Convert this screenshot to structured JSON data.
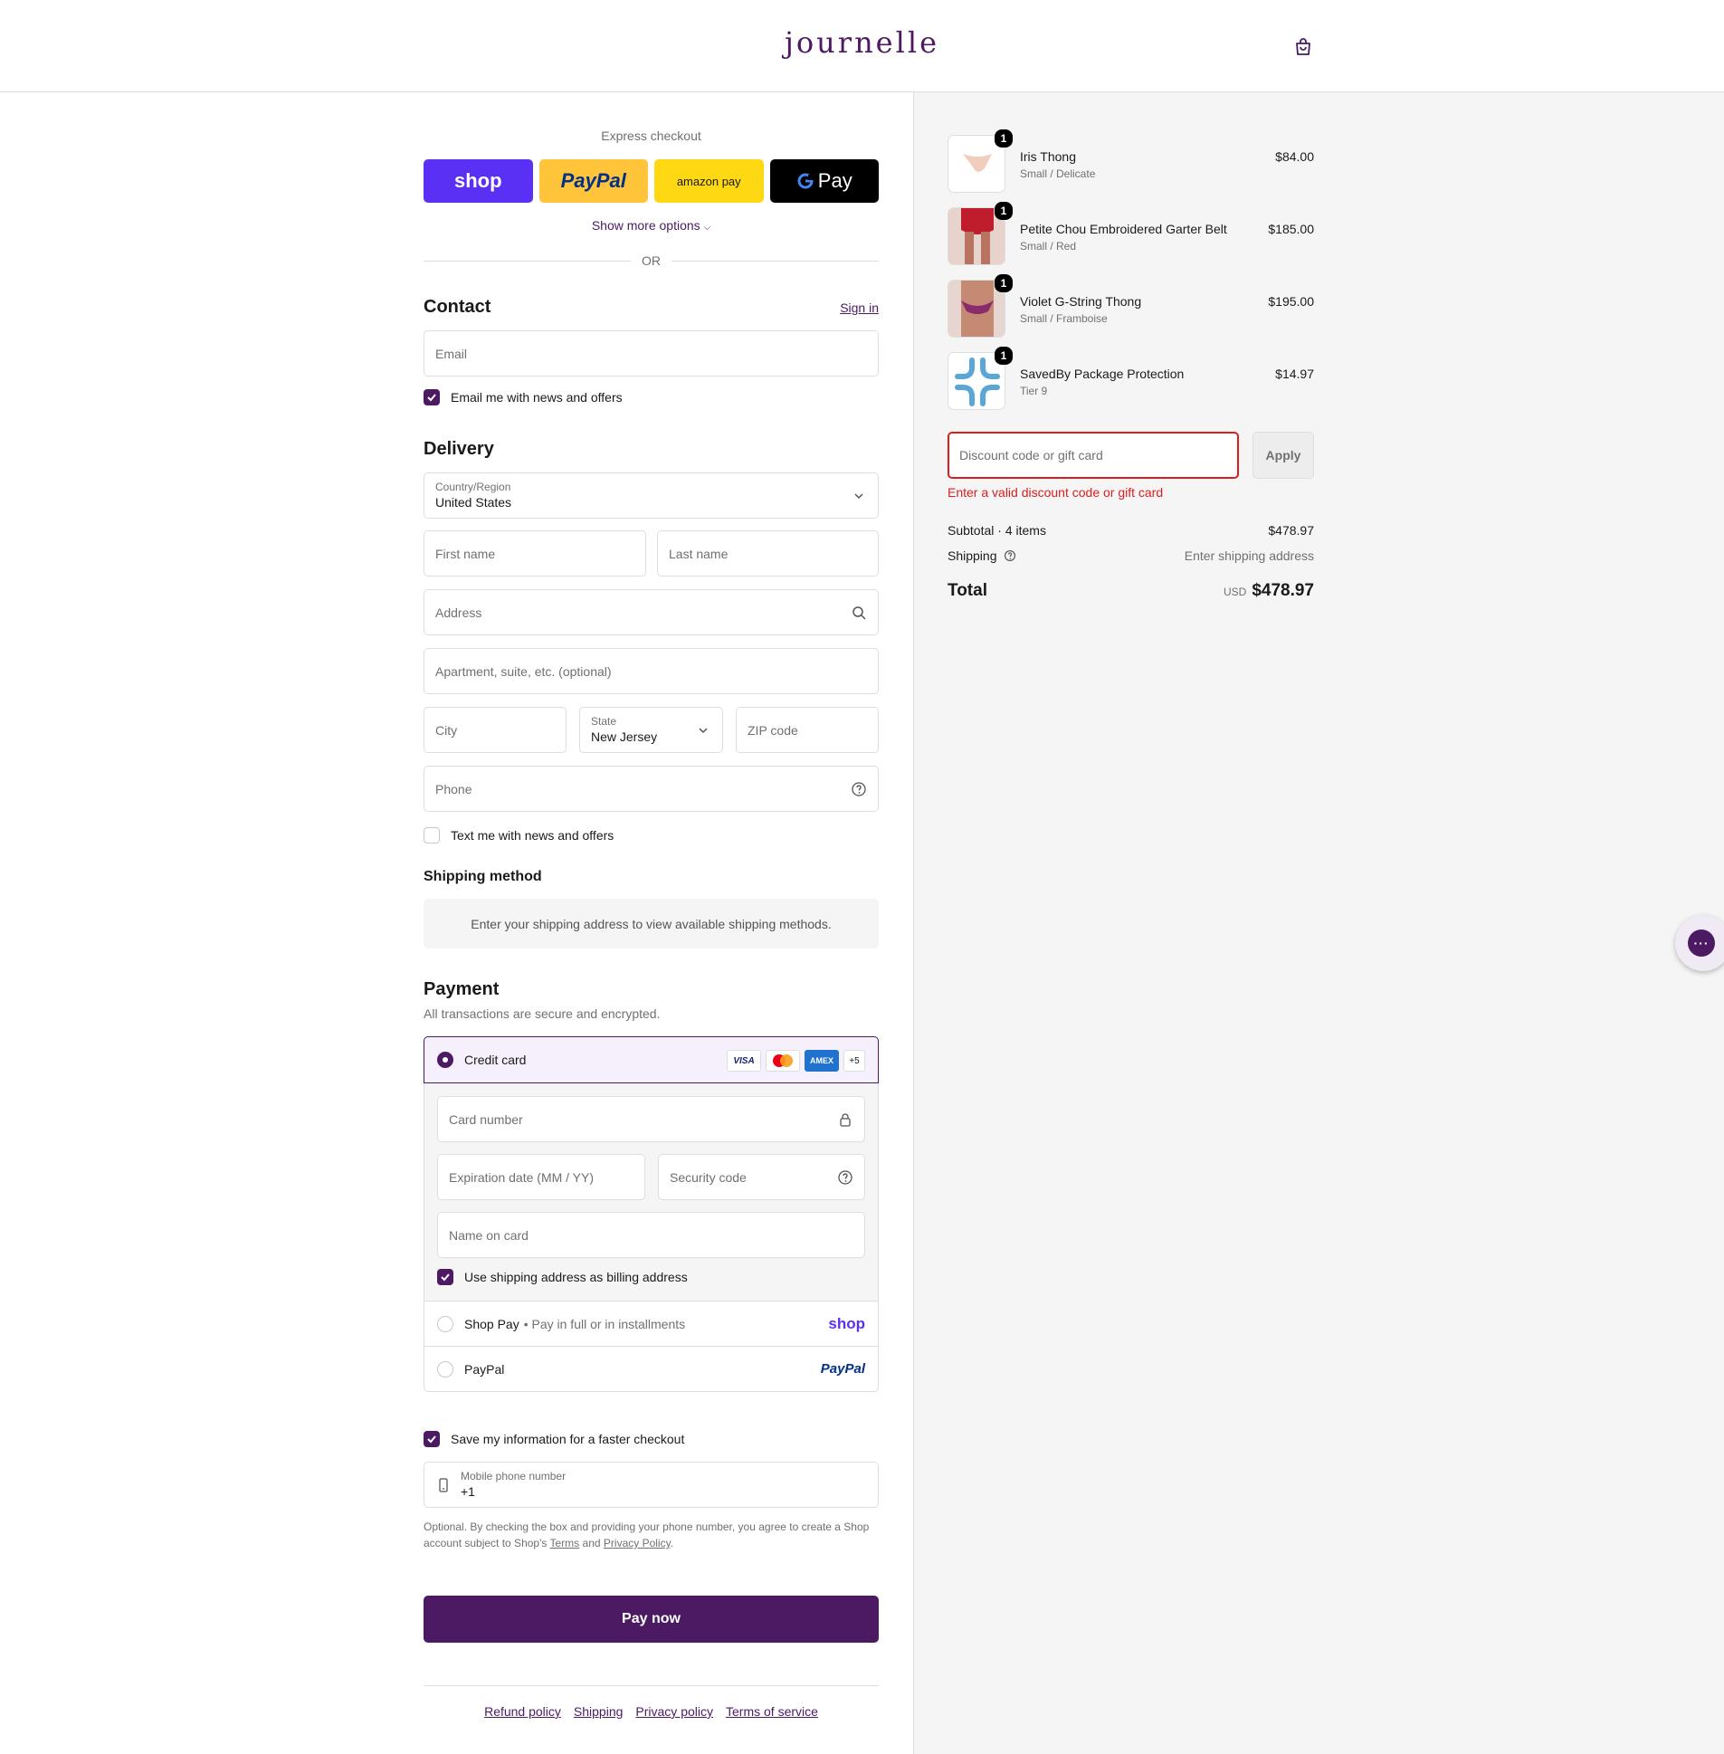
{
  "header": {
    "logo": "journelle",
    "cart_icon": "shopping-bag-icon"
  },
  "express": {
    "title": "Express checkout",
    "buttons": {
      "shop": "shop",
      "paypal": "PayPal",
      "amazon": "amazon pay",
      "gpay": "Pay"
    },
    "show_more": "Show more options",
    "or": "OR"
  },
  "contact": {
    "title": "Contact",
    "sign_in": "Sign in",
    "email_placeholder": "Email",
    "news_label": "Email me with news and offers",
    "news_checked": true
  },
  "delivery": {
    "title": "Delivery",
    "country_label": "Country/Region",
    "country_value": "United States",
    "first_name_placeholder": "First name",
    "last_name_placeholder": "Last name",
    "address_placeholder": "Address",
    "apartment_placeholder": "Apartment, suite, etc. (optional)",
    "city_placeholder": "City",
    "state_label": "State",
    "state_value": "New Jersey",
    "zip_placeholder": "ZIP code",
    "phone_placeholder": "Phone",
    "text_label": "Text me with news and offers",
    "text_checked": false
  },
  "shipping_method": {
    "title": "Shipping method",
    "message": "Enter your shipping address to view available shipping methods."
  },
  "payment": {
    "title": "Payment",
    "subtitle": "All transactions are secure and encrypted.",
    "credit_card_label": "Credit card",
    "card_logos": {
      "visa": "VISA",
      "amex": "AMEX",
      "more": "+5"
    },
    "card_number_placeholder": "Card number",
    "expiry_placeholder": "Expiration date (MM / YY)",
    "security_placeholder": "Security code",
    "name_placeholder": "Name on card",
    "billing_label": "Use shipping address as billing address",
    "shop_pay_label": "Shop Pay",
    "shop_pay_desc": "• Pay in full or in installments",
    "shop_pay_logo": "shop",
    "paypal_label": "PayPal",
    "paypal_logo": "PayPal"
  },
  "save_info": {
    "label": "Save my information for a faster checkout",
    "phone_label": "Mobile phone number",
    "phone_value": "+1",
    "disclaimer_pre": "Optional. By checking the box and providing your phone number, you agree to create a Shop account subject to Shop's",
    "terms": "Terms",
    "and": "and",
    "privacy": "Privacy Policy",
    "period": "."
  },
  "pay_now": "Pay now",
  "footer": {
    "refund": "Refund policy",
    "shipping": "Shipping",
    "privacy": "Privacy policy",
    "terms": "Terms of service"
  },
  "summary": {
    "items": [
      {
        "name": "Iris Thong",
        "variant": "Small / Delicate",
        "price": "$84.00",
        "qty": "1"
      },
      {
        "name": "Petite Chou Embroidered Garter Belt",
        "variant": "Small / Red",
        "price": "$185.00",
        "qty": "1"
      },
      {
        "name": "Violet G-String Thong",
        "variant": "Small / Framboise",
        "price": "$195.00",
        "qty": "1"
      },
      {
        "name": "SavedBy Package Protection",
        "variant": "Tier 9",
        "price": "$14.97",
        "qty": "1"
      }
    ],
    "discount_placeholder": "Discount code or gift card",
    "apply": "Apply",
    "discount_error": "Enter a valid discount code or gift card",
    "subtotal_label": "Subtotal · 4 items",
    "subtotal_value": "$478.97",
    "shipping_label": "Shipping",
    "shipping_value": "Enter shipping address",
    "total_label": "Total",
    "currency": "USD",
    "total_value": "$478.97"
  },
  "colors": {
    "accent": "#4b1a63",
    "error": "#dd1d1d",
    "shop_purple": "#5a31f4",
    "paypal_yellow": "#ffc439",
    "amazon_yellow": "#ffd814"
  }
}
